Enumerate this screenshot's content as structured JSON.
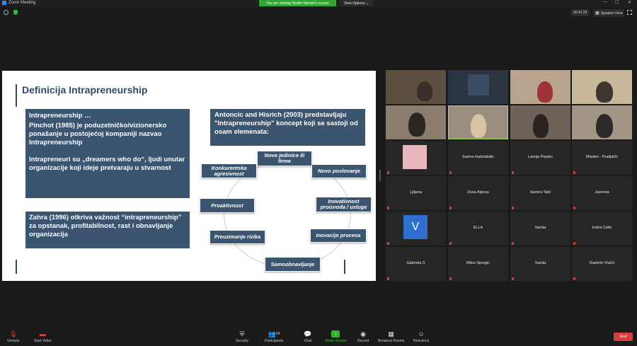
{
  "window": {
    "title": "Zoom Meeting",
    "banner": "You are viewing Nadim Sfendić's screen",
    "view_options": "View Options ⌄",
    "timer": "00:41:23",
    "speaker_view": "Speaker View"
  },
  "slide": {
    "title": "Definicija Intrapreneurship",
    "box1_p1": "Intrapreneurship …",
    "box1_p2": "Pinchot (1985) je poduzetničko/vizionersko ponašanje u postojećoj kompaniji nazvao Intrapreneurship",
    "box1_p3": "Intrapreneuri su „dreamers who do“, ljudi unutar organizacije koji ideje pretvaraju u stvarnost",
    "box2": "Zahra (1996) otkriva važnost “intrapreneurship” za opstanak, profitabilnost, rast i obnavljanje organizacija",
    "box3": "Antoncic and Hisrich (2003) predstavljaju \"Intrapreneurship\" koncept koji se sastoji od osam elemenata:",
    "nodes": [
      "Nove  jedinice ili firme",
      "Novo poslovanje",
      "Inovativnost proizvoda / usluge",
      "Inovacije procesa",
      "Samoobnavljanje",
      "Preuzimanje rizika",
      "Proaktivnost",
      "Konkurentska agresivnost"
    ]
  },
  "gallery": {
    "tiles": [
      {
        "name": ""
      },
      {
        "name": ""
      },
      {
        "name": ""
      },
      {
        "name": ""
      },
      {
        "name": ""
      },
      {
        "name": ""
      },
      {
        "name": ""
      },
      {
        "name": ""
      },
      {
        "name": ""
      },
      {
        "name": "Samra Hadziabdic"
      },
      {
        "name": "Lamija Pojskic"
      },
      {
        "name": "Mladen - Pratljačić"
      },
      {
        "name": "Ljiljana"
      },
      {
        "name": "Zana Alpeza"
      },
      {
        "name": "Samira Talić"
      },
      {
        "name": "Jasmina"
      },
      {
        "name": ""
      },
      {
        "name": "ELLA"
      },
      {
        "name": "Sanita"
      },
      {
        "name": "Indira Celik"
      },
      {
        "name": "Gabriela S"
      },
      {
        "name": "Milos Spragic"
      },
      {
        "name": "Sanita"
      },
      {
        "name": "Vladimir Vlačić"
      }
    ]
  },
  "toolbar": {
    "unmute": "Unmute",
    "start_video": "Start Video",
    "security": "Security",
    "participants": "Participants",
    "participants_count": "24",
    "chat": "Chat",
    "share_screen": "Share Screen",
    "record": "Record",
    "breakout": "Breakout Rooms",
    "reactions": "Reactions",
    "end": "End"
  },
  "colors": {
    "slide_box": "#3b5470",
    "banner_green": "#35a535",
    "end_red": "#d93d3d",
    "active_speaker": "#9ee04a"
  }
}
